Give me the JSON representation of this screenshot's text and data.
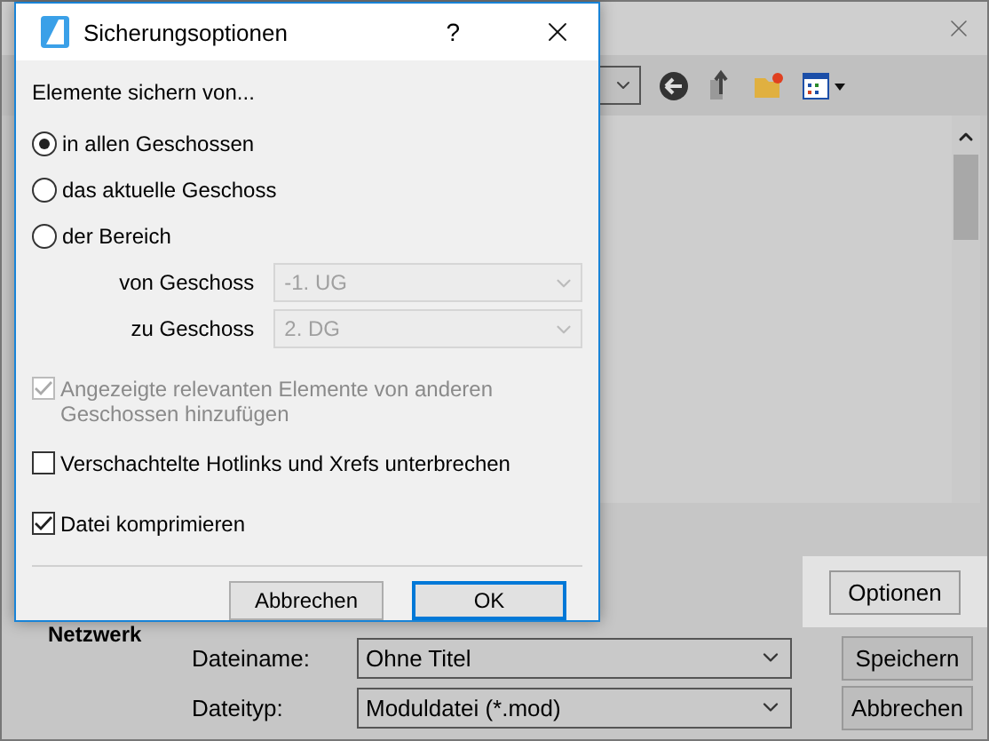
{
  "background": {
    "sidebar_item": "Netzwerk",
    "options_button": "Optionen",
    "fields": [
      {
        "label": "Dateiname:",
        "value": "Ohne Titel"
      },
      {
        "label": "Dateityp:",
        "value": "Moduldatei (*.mod)"
      }
    ],
    "buttons": [
      "Speichern",
      "Abbrechen"
    ]
  },
  "dialog": {
    "title": "Sicherungsoptionen",
    "help": "?",
    "group_label": "Elemente sichern von...",
    "options": [
      {
        "label": "in allen Geschossen",
        "selected": true
      },
      {
        "label": "das aktuelle Geschoss",
        "selected": false
      },
      {
        "label": "der Bereich",
        "selected": false
      }
    ],
    "range": [
      {
        "label": "von Geschoss",
        "value": "-1. UG",
        "disabled": true
      },
      {
        "label": "zu Geschoss",
        "value": "2. DG",
        "disabled": true
      }
    ],
    "checks": [
      {
        "label": "Angezeigte relevanten Elemente von anderen Geschossen hinzufügen",
        "checked": true,
        "disabled": true
      },
      {
        "label": "Verschachtelte Hotlinks und Xrefs unterbrechen",
        "checked": false,
        "disabled": false
      },
      {
        "label": "Datei komprimieren",
        "checked": true,
        "disabled": false
      }
    ],
    "buttons": [
      {
        "label": "Abbrechen",
        "default": false
      },
      {
        "label": "OK",
        "default": true
      }
    ]
  }
}
